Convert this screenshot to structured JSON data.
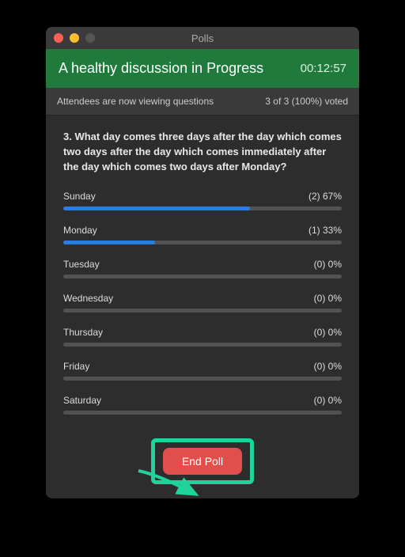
{
  "window": {
    "title": "Polls"
  },
  "header": {
    "title": "A healthy discussion in Progress",
    "timer": "00:12:57"
  },
  "status": {
    "left": "Attendees are now viewing questions",
    "right": "3 of 3 (100%) voted"
  },
  "question": {
    "text": "3. What day comes three days after the day which comes two days after the day which comes immediately after the day which comes two days after Monday?"
  },
  "options": [
    {
      "label": "Sunday",
      "count": "(2) 67%",
      "pct": 67
    },
    {
      "label": "Monday",
      "count": "(1) 33%",
      "pct": 33
    },
    {
      "label": "Tuesday",
      "count": "(0) 0%",
      "pct": 0
    },
    {
      "label": "Wednesday",
      "count": "(0) 0%",
      "pct": 0
    },
    {
      "label": "Thursday",
      "count": "(0) 0%",
      "pct": 0
    },
    {
      "label": "Friday",
      "count": "(0) 0%",
      "pct": 0
    },
    {
      "label": "Saturday",
      "count": "(0) 0%",
      "pct": 0
    }
  ],
  "footer": {
    "end_label": "End Poll"
  },
  "colors": {
    "accent": "#1fd39a",
    "bar": "#2a7de1",
    "header": "#1f7a3c",
    "danger": "#e04f4b"
  }
}
